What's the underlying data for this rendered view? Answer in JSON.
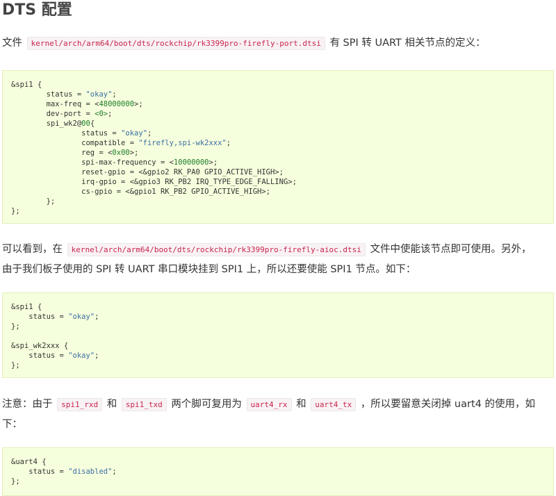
{
  "heading": "DTS 配置",
  "para1": {
    "before": "文件",
    "code": "kernel/arch/arm64/boot/dts/rockchip/rk3399pro-firefly-port.dtsi",
    "after": "有 SPI 转 UART 相关节点的定义："
  },
  "code1": {
    "lines": [
      "&spi1 {",
      "\tstatus = \"okay\";",
      "\tmax-freq = <48000000>;",
      "\tdev-port = <0>;",
      "\tspi_wk2@00{",
      "\t\tstatus = \"okay\";",
      "\t\tcompatible = \"firefly,spi-wk2xxx\";",
      "\t\treg = <0x00>;",
      "\t\tspi-max-frequency = <10000000>;",
      "\t\treset-gpio = <&gpio2 RK_PA0 GPIO_ACTIVE_HIGH>;",
      "\t\tirq-gpio = <&gpio3 RK_PB2 IRQ_TYPE_EDGE_FALLING>;",
      "\t\tcs-gpio = <&gpio1 RK_PB2 GPIO_ACTIVE_HIGH>;",
      "\t};",
      "};"
    ]
  },
  "para2": {
    "before": "可以看到，在",
    "code": "kernel/arch/arm64/boot/dts/rockchip/rk3399pro-firefly-aioc.dtsi",
    "after": "文件中使能该节点即可使用。另外，",
    "line2": "由于我们板子使用的 SPI 转 UART 串口模块挂到 SPI1 上，所以还要使能 SPI1 节点。如下："
  },
  "code2": {
    "lines": [
      "&spi1 {",
      "    status = \"okay\";",
      "};",
      "",
      "&spi_wk2xxx {",
      "    status = \"okay\";",
      "};"
    ]
  },
  "para3": {
    "t1": "注意：由于",
    "c1": "spi1_rxd",
    "t2": "和",
    "c2": "spi1_txd",
    "t3": "两个脚可复用为",
    "c3": "uart4_rx",
    "t4": "和",
    "c4": "uart4_tx",
    "t5": "，所以要留意关闭掉 uart4 的使用，如",
    "line2": "下："
  },
  "code3": {
    "lines": [
      "&uart4 {",
      "    status = \"disabled\";",
      "};"
    ]
  }
}
